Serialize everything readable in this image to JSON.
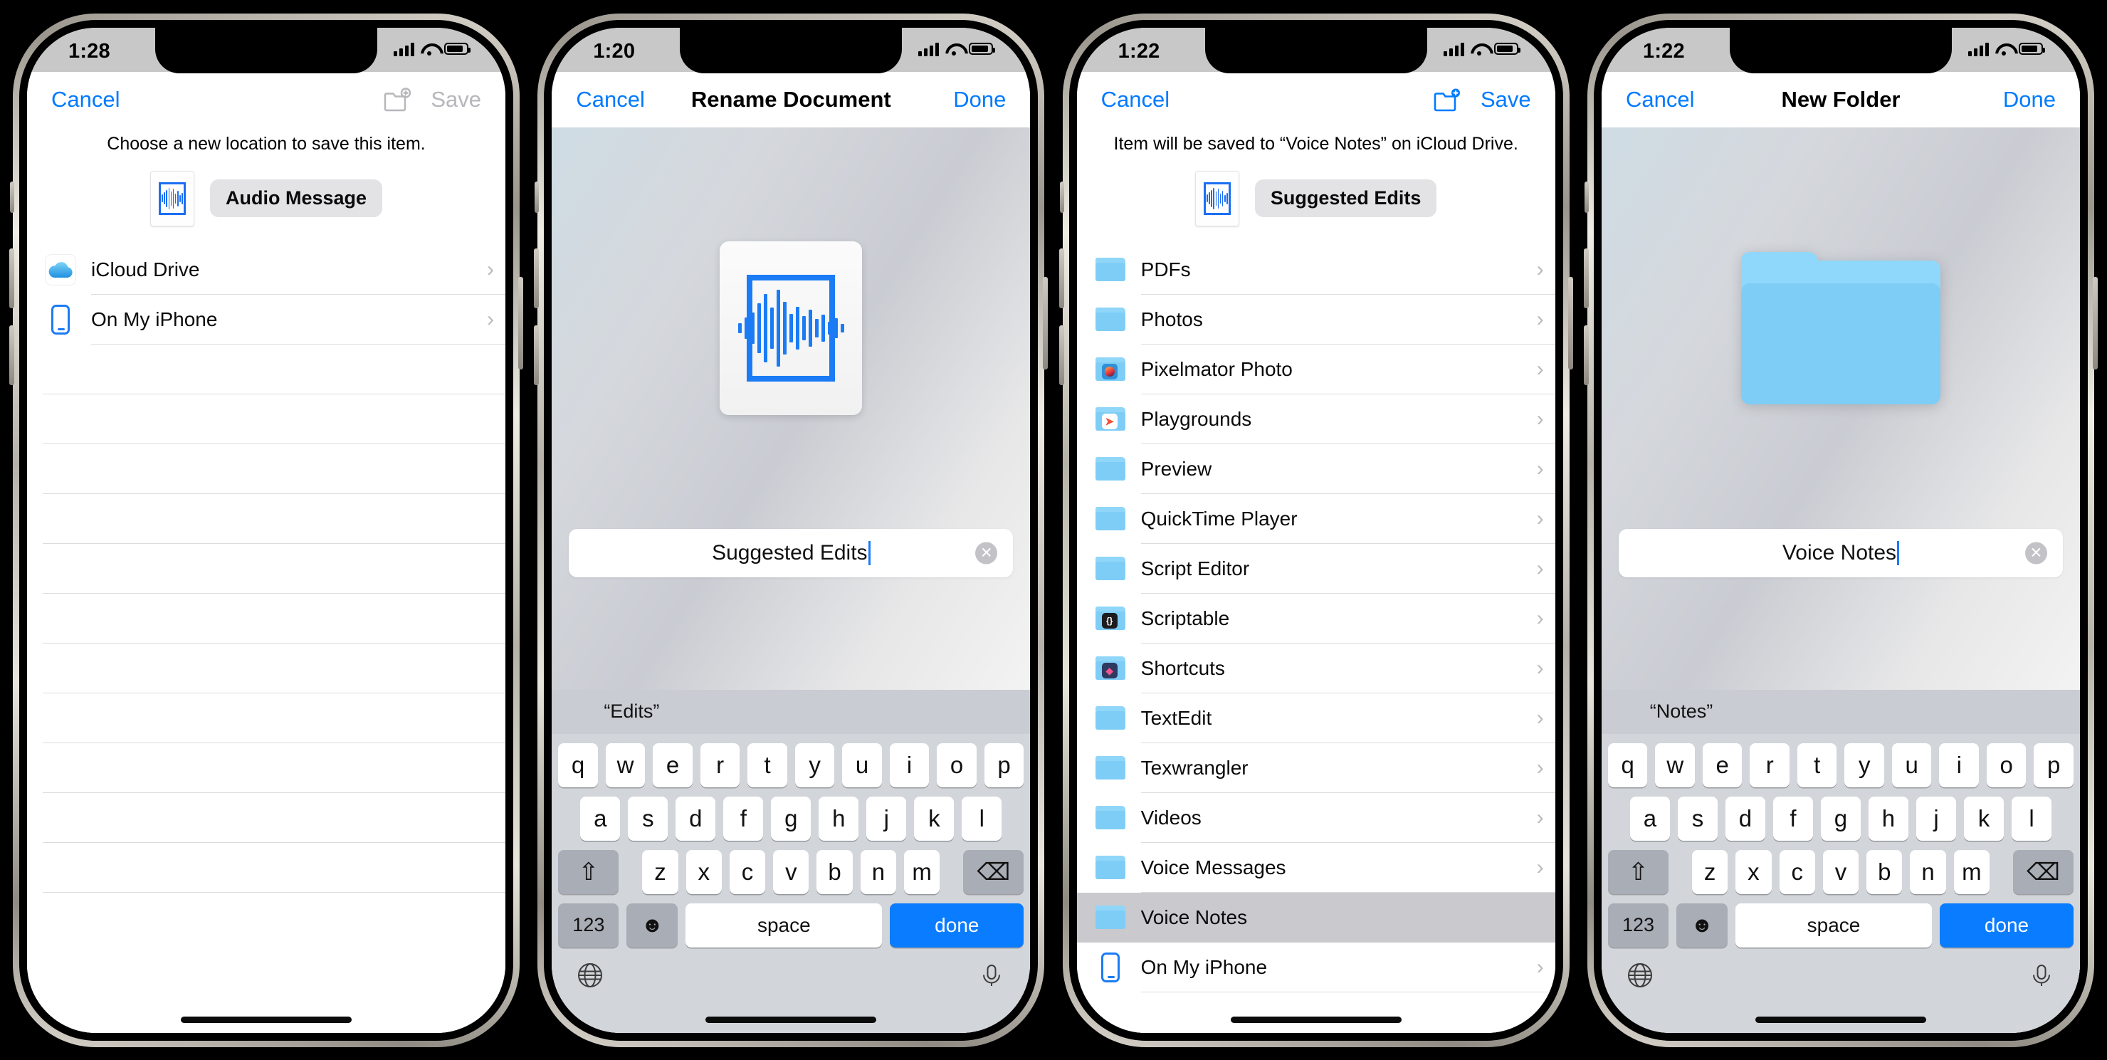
{
  "devices": [
    {
      "id": "save-location-picker",
      "status": {
        "time": "1:28"
      },
      "nav": {
        "left": "Cancel",
        "title": "",
        "right": "Save",
        "right_enabled": false,
        "has_new_folder_icon": true,
        "new_folder_color": "#b6b6bb"
      },
      "hint": "Choose a new location to save this item.",
      "chip": {
        "label": "Audio Message",
        "thumb_icon": "audio-waveform-document-icon"
      },
      "rows": [
        {
          "label": "iCloud Drive",
          "icon": "icloud-drive-icon",
          "chevron": true
        },
        {
          "label": "On My iPhone",
          "icon": "iphone-icon",
          "chevron": true
        }
      ],
      "empty_rows": 11
    },
    {
      "id": "rename-document",
      "status": {
        "time": "1:20"
      },
      "nav": {
        "left": "Cancel",
        "title": "Rename Document",
        "right": "Done",
        "right_enabled": true,
        "has_new_folder_icon": false
      },
      "hero_icon": "audio-waveform-document-icon",
      "textfield": {
        "value": "Suggested Edits",
        "clear_icon": "clear-circle-icon"
      },
      "keyboard": {
        "suggestions": [
          "“Edits”",
          "",
          ""
        ],
        "row1": [
          "q",
          "w",
          "e",
          "r",
          "t",
          "y",
          "u",
          "i",
          "o",
          "p"
        ],
        "row2": [
          "a",
          "s",
          "d",
          "f",
          "g",
          "h",
          "j",
          "k",
          "l"
        ],
        "row3": [
          "z",
          "x",
          "c",
          "v",
          "b",
          "n",
          "m"
        ],
        "shift_icon": "shift-arrow-icon",
        "backspace_icon": "backspace-icon",
        "numbers_key": "123",
        "emoji_icon": "emoji-smiley-icon",
        "space_key": "space",
        "return_key": "done",
        "globe_icon": "globe-icon",
        "mic_icon": "microphone-icon"
      }
    },
    {
      "id": "icloud-folder-list",
      "status": {
        "time": "1:22"
      },
      "nav": {
        "left": "Cancel",
        "title": "",
        "right": "Save",
        "right_enabled": true,
        "has_new_folder_icon": true,
        "new_folder_color": "#007aff"
      },
      "hint": "Item will be saved to “Voice Notes” on iCloud Drive.",
      "chip": {
        "label": "Suggested Edits",
        "thumb_icon": "audio-waveform-document-icon"
      },
      "rows": [
        {
          "label": "PDFs",
          "icon": "folder-icon",
          "chevron": true
        },
        {
          "label": "Photos",
          "icon": "folder-icon",
          "chevron": true
        },
        {
          "label": "Pixelmator Photo",
          "icon": "folder-app-pixelmator-icon",
          "chevron": true,
          "badge_bg": "#3399e6",
          "badge_glyph": "●",
          "badge_color": "#ff9a2e"
        },
        {
          "label": "Playgrounds",
          "icon": "folder-app-playgrounds-icon",
          "chevron": true,
          "badge_bg": "#ffffff",
          "badge_glyph": "◥",
          "badge_color": "#f05138"
        },
        {
          "label": "Preview",
          "icon": "folder-icon",
          "chevron": true
        },
        {
          "label": "QuickTime Player",
          "icon": "folder-icon",
          "chevron": true
        },
        {
          "label": "Script Editor",
          "icon": "folder-icon",
          "chevron": true
        },
        {
          "label": "Scriptable",
          "icon": "folder-app-scriptable-icon",
          "chevron": true,
          "badge_bg": "#1c1c1e",
          "badge_glyph": "{}",
          "badge_color": "#ffffff"
        },
        {
          "label": "Shortcuts",
          "icon": "folder-app-shortcuts-icon",
          "chevron": true,
          "badge_bg": "#2f3a60",
          "badge_glyph": "◆",
          "badge_color": "#f2558e"
        },
        {
          "label": "TextEdit",
          "icon": "folder-icon",
          "chevron": true
        },
        {
          "label": "Texwrangler",
          "icon": "folder-icon",
          "chevron": true
        },
        {
          "label": "Videos",
          "icon": "folder-icon",
          "chevron": true
        },
        {
          "label": "Voice Messages",
          "icon": "folder-icon",
          "chevron": true
        },
        {
          "label": "Voice Notes",
          "icon": "folder-icon",
          "chevron": false,
          "selected": true
        },
        {
          "label": "On My iPhone",
          "icon": "iphone-icon",
          "chevron": true
        }
      ]
    },
    {
      "id": "new-folder",
      "status": {
        "time": "1:22"
      },
      "nav": {
        "left": "Cancel",
        "title": "New Folder",
        "right": "Done",
        "right_enabled": true,
        "has_new_folder_icon": false
      },
      "hero_icon": "folder-large-icon",
      "textfield": {
        "value": "Voice Notes",
        "clear_icon": "clear-circle-icon"
      },
      "keyboard": {
        "suggestions": [
          "“Notes”",
          "",
          ""
        ],
        "row1": [
          "q",
          "w",
          "e",
          "r",
          "t",
          "y",
          "u",
          "i",
          "o",
          "p"
        ],
        "row2": [
          "a",
          "s",
          "d",
          "f",
          "g",
          "h",
          "j",
          "k",
          "l"
        ],
        "row3": [
          "z",
          "x",
          "c",
          "v",
          "b",
          "n",
          "m"
        ],
        "shift_icon": "shift-arrow-icon",
        "backspace_icon": "backspace-icon",
        "numbers_key": "123",
        "emoji_icon": "emoji-smiley-icon",
        "space_key": "space",
        "return_key": "done",
        "globe_icon": "globe-icon",
        "mic_icon": "microphone-icon"
      }
    }
  ],
  "colors": {
    "accent": "#007aff",
    "folder": "#7ecdf6",
    "return_key": "#0a7cff",
    "selected_row": "#c9c9ce"
  }
}
